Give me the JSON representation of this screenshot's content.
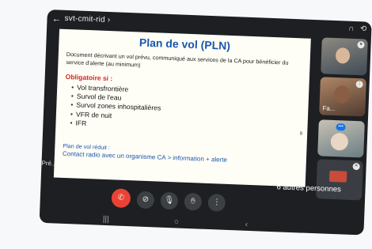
{
  "meeting": {
    "code": "svt-cmit-rid",
    "code_suffix": "›"
  },
  "slide": {
    "title": "Plan de vol (PLN)",
    "description": "Document décrivant un vol prévu, communiqué aux services de la CA pour bénéficier du service d'alerte (au minimum)",
    "required_heading": "Obligatoire si :",
    "required_items": [
      "Vol transfrontière",
      "Survol de l'eau",
      "Survol zones inhospitalières",
      "VFR de nuit",
      "IFR"
    ],
    "reduced_heading": "Plan de vol réduit :",
    "reduced_text": "Contact radio avec un organisme CA > information + alerte",
    "page_number": "8"
  },
  "presenter_label": "Pré...",
  "participants": {
    "tile2_name": "Fa...",
    "others_label": "6 autres personnes"
  },
  "icons": {
    "back": "back-arrow-icon",
    "headset": "headset-icon",
    "camera_switch": "camera-switch-icon",
    "hangup": "hang-up-icon",
    "camera_off": "camera-off-icon",
    "mic_off": "mic-off-icon",
    "raise_hand": "raise-hand-icon",
    "more": "more-options-icon"
  },
  "colors": {
    "hangup": "#ea4335",
    "title_blue": "#1a56b0",
    "required_red": "#d2281e",
    "speaking_blue": "#1a73e8"
  }
}
